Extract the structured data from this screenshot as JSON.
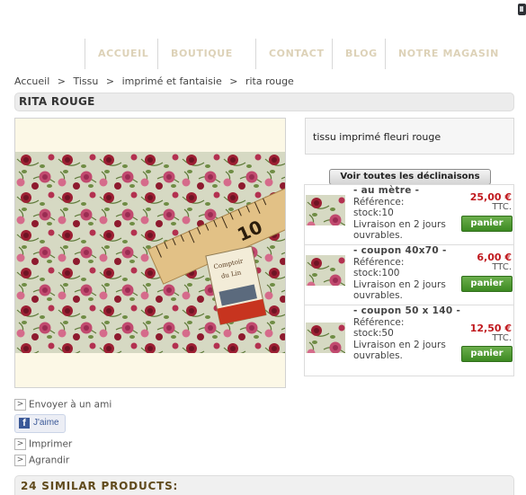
{
  "nav": {
    "items": [
      "ACCUEIL",
      "BOUTIQUE",
      "CONTACT",
      "BLOG",
      "NOTRE MAGASIN"
    ]
  },
  "breadcrumb": {
    "items": [
      "Accueil",
      "Tissu",
      "imprimé et fantaisie",
      "rita rouge"
    ],
    "separator": ">"
  },
  "product": {
    "title": "RITA ROUGE",
    "description": "tissu imprimé fleuri rouge",
    "photo": {
      "ruler_text": "10",
      "card_text_line1": "Comptoir",
      "card_text_line2": "du Lin"
    }
  },
  "declinaisons": {
    "button_label": "Voir toutes les déclinaisons",
    "items": [
      {
        "name": "-   au mètre  -",
        "reference": "Référence:",
        "stock": "stock:10",
        "delivery": "Livraison en 2 jours ouvrables.",
        "price": "25,00 €",
        "tax": "TTC.",
        "button": "panier"
      },
      {
        "name": "-   coupon 40x70  -",
        "reference": "Référence:",
        "stock": "stock:100",
        "delivery": "Livraison en 2 jours ouvrables.",
        "price": "6,00 €",
        "tax": "TTC.",
        "button": "panier"
      },
      {
        "name": "-   coupon 50 x 140  -",
        "reference": "Référence:",
        "stock": "stock:50",
        "delivery": "Livraison en 2 jours ouvrables.",
        "price": "12,50 €",
        "tax": "TTC.",
        "button": "panier"
      }
    ]
  },
  "actions": {
    "send": "Envoyer à un ami",
    "like": "J'aime",
    "print": "Imprimer",
    "enlarge": "Agrandir",
    "arrow": ">"
  },
  "similar": {
    "title": "24 SIMILAR PRODUCTS:"
  },
  "colors": {
    "price": "#c0191e",
    "panier": "#4c9a2e",
    "nav": "#ddd2b8",
    "similar_title": "#604a1c"
  }
}
